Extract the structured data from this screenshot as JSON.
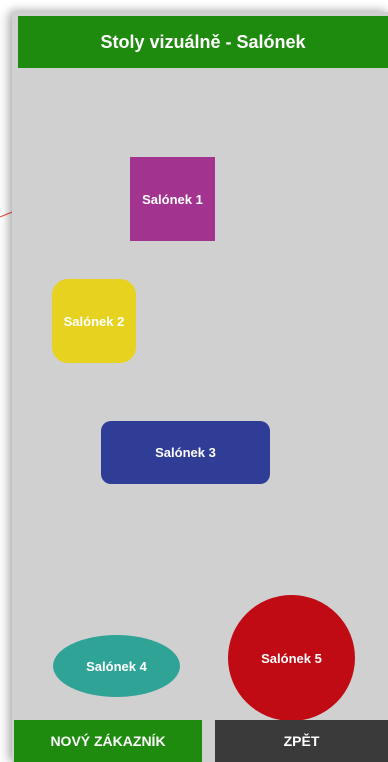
{
  "header": {
    "title": "Stoly vizuálně - Salónek"
  },
  "tables": [
    {
      "label": "Salónek 1",
      "color": "#a2338e",
      "shape": "square"
    },
    {
      "label": "Salónek 2",
      "color": "#e6d21f",
      "shape": "rounded-square"
    },
    {
      "label": "Salónek 3",
      "color": "#2f3d97",
      "shape": "rounded-rectangle"
    },
    {
      "label": "Salónek 4",
      "color": "#30a397",
      "shape": "ellipse"
    },
    {
      "label": "Salónek 5",
      "color": "#c00a14",
      "shape": "circle"
    }
  ],
  "footer": {
    "new_customer_label": "NOVÝ ZÁKAZNÍK",
    "back_label": "ZPĚT"
  },
  "colors": {
    "header": "#1e8a0e",
    "background": "#d0d0d0",
    "back_button": "#3a3a3a"
  }
}
